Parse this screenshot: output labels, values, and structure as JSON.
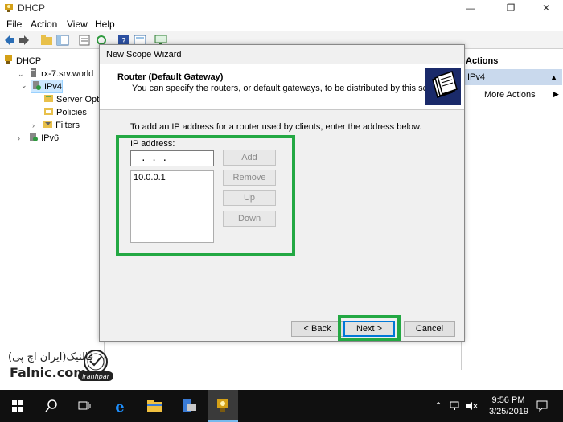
{
  "window": {
    "title": "DHCP"
  },
  "menu": [
    "File",
    "Action",
    "View",
    "Help"
  ],
  "tree": {
    "root": "DHCP",
    "server": "rx-7.srv.world",
    "ipv4": "IPv4",
    "server_options": "Server Opti",
    "policies": "Policies",
    "filters": "Filters",
    "ipv6": "IPv6"
  },
  "actions": {
    "header": "Actions",
    "section": "IPv4",
    "more": "More Actions"
  },
  "dialog": {
    "title": "New Scope Wizard",
    "heading": "Router (Default Gateway)",
    "subheading": "You can specify the routers, or default gateways, to be distributed by this scope.",
    "instruction": "To add an IP address for a router used by clients, enter the address below.",
    "ip_label": "IP address:",
    "ip_value": ".   .   .",
    "list": [
      "10.0.0.1"
    ],
    "buttons": {
      "add": "Add",
      "remove": "Remove",
      "up": "Up",
      "down": "Down",
      "back": "< Back",
      "next": "Next >",
      "cancel": "Cancel"
    }
  },
  "watermark": {
    "persian": "فالنیک(ایران اچ پی)",
    "brand": "Falnic.com",
    "badge": "iranhpar"
  },
  "taskbar": {
    "time": "9:56 PM",
    "date": "3/25/2019"
  },
  "colors": {
    "highlight_box": "#23a843",
    "taskbar": "#101010",
    "wizard_icon_bg": "#1a2a6a"
  }
}
